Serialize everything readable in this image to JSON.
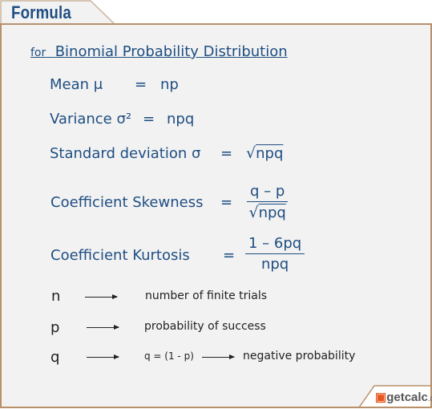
{
  "header": {
    "title": "Formula"
  },
  "subtitle": {
    "prefix": "for",
    "text": "Binomial Probability Distribution"
  },
  "formulas": {
    "mean": {
      "label": "Mean μ",
      "eq": "=",
      "rhs": "np"
    },
    "variance": {
      "label": "Variance σ²",
      "eq": "=",
      "rhs": "npq"
    },
    "sd": {
      "label": "Standard deviation σ",
      "eq": "=",
      "root": "√",
      "rhs": "npq"
    },
    "skewness": {
      "label": "Coefficient Skewness",
      "eq": "=",
      "num": "q – p",
      "root": "√",
      "den": "npq"
    },
    "kurtosis": {
      "label": "Coefficient Kurtosis",
      "eq": "=",
      "num": "1 – 6pq",
      "den": "npq"
    }
  },
  "legend": [
    {
      "symbol": "n",
      "text": "number of finite trials"
    },
    {
      "symbol": "p",
      "text": "probability of success"
    },
    {
      "symbol": "q",
      "text": "q = (1 - p)",
      "text2": "negative probability"
    }
  ],
  "logo": {
    "text": "getcalc.com"
  },
  "colors": {
    "text": "#1f4e82",
    "border": "#b8906a",
    "background": "#f2f2f2",
    "logo_accent": "#e8571f"
  }
}
